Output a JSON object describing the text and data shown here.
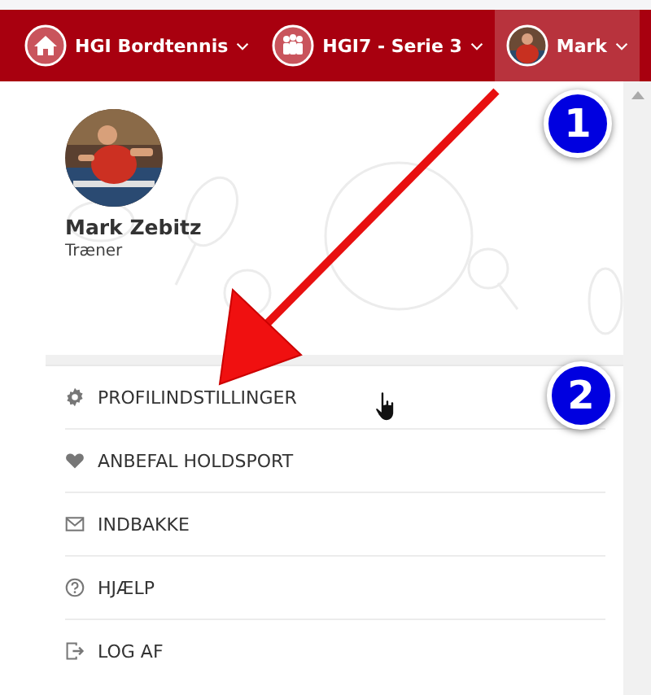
{
  "nav": [
    {
      "kind": "home",
      "label": "HGI Bordtennis",
      "selected": false
    },
    {
      "kind": "team",
      "label": "HGI7 - Serie 3",
      "selected": false
    },
    {
      "kind": "user",
      "label": "Mark",
      "selected": true
    }
  ],
  "profile": {
    "name": "Mark Zebitz",
    "role": "Træner"
  },
  "menu": [
    {
      "kind": "settings",
      "label": "PROFILINDSTILLINGER"
    },
    {
      "kind": "heart",
      "label": "ANBEFAL HOLDSPORT"
    },
    {
      "kind": "mail",
      "label": "INDBAKKE"
    },
    {
      "kind": "help",
      "label": "HJÆLP"
    },
    {
      "kind": "logout",
      "label": "LOG AF"
    }
  ],
  "badges": [
    "1",
    "2"
  ]
}
